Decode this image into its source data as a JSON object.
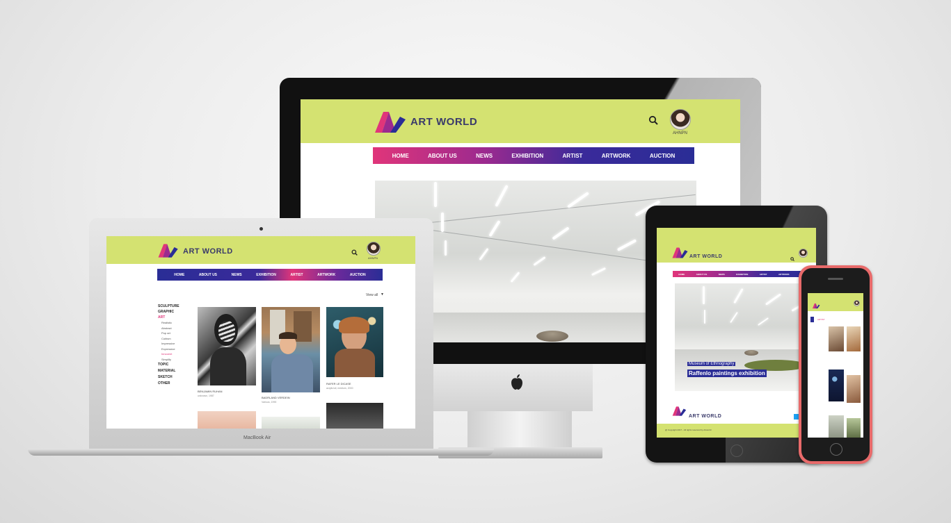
{
  "site": {
    "brand": "ART WORLD",
    "user": "AHNPN",
    "nav": [
      "HOME",
      "ABOUT US",
      "NEWS",
      "EXHIBITION",
      "ARTIST",
      "ARTWORK",
      "AUCTION"
    ]
  },
  "laptop": {
    "brand_label": "MacBook Air",
    "view_all": "View all",
    "categories": [
      "SCULPTURE",
      "GRAPHIC",
      "ART"
    ],
    "subcategories": [
      "Realistic",
      "Abstract",
      "Pop art",
      "Cubism",
      "Impressive",
      "Expressive",
      "Innocent",
      "Simplify"
    ],
    "more_categories": [
      "TOPIC",
      "MATERIAL",
      "SKETCH",
      "OTHER"
    ],
    "artworks": [
      {
        "title": "BENJAMIN RUHAN",
        "meta": "unknown, 1987"
      },
      {
        "title": "BADRLAND VERDEIN",
        "meta": "Various, 1990"
      },
      {
        "title": "RAFER LE DICASE",
        "meta": "acrylic/oil, medium, 2000"
      }
    ]
  },
  "tablet": {
    "tag": "Museum of Ethnography",
    "headline": "Raffenlo paintings exhibition",
    "footer_note": "@ Copyright 2017 - All rights reserved by Artworld"
  },
  "phone": {
    "label": "ARTIST"
  },
  "colors": {
    "lime": "#d4e271",
    "pink": "#e0357a",
    "indigo": "#2a2d96"
  }
}
